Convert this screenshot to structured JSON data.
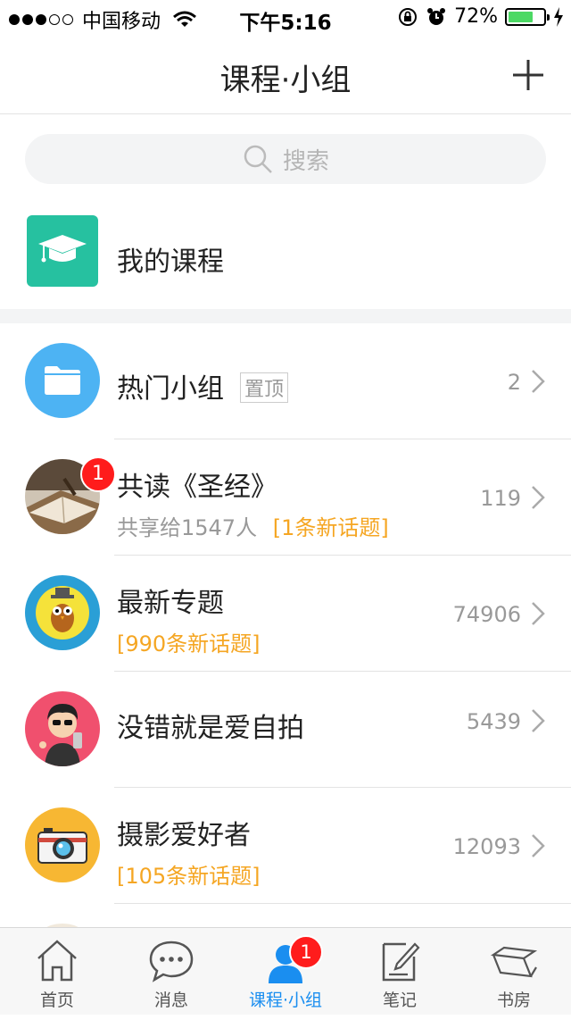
{
  "status_bar": {
    "carrier": "中国移动",
    "time": "下午5:16",
    "battery": "72%",
    "battery_level": 0.72
  },
  "nav": {
    "title": "课程·小组"
  },
  "search": {
    "placeholder": "搜索"
  },
  "my_course": {
    "label": "我的课程"
  },
  "groups": [
    {
      "title": "热门小组",
      "tag": "置顶",
      "count": "2"
    },
    {
      "title": "共读《圣经》",
      "sub_gray": "共享给1547人",
      "sub_orange": "[1条新话题]",
      "count": "119",
      "badge": "1"
    },
    {
      "title": "最新专题",
      "sub_orange": "[990条新话题]",
      "count": "74906"
    },
    {
      "title": "没错就是爱自拍",
      "count": "5439"
    },
    {
      "title": "摄影爱好者",
      "sub_orange": "[105条新话题]",
      "count": "12093"
    }
  ],
  "tabs": [
    {
      "label": "首页",
      "icon": "home-icon"
    },
    {
      "label": "消息",
      "icon": "message-icon"
    },
    {
      "label": "课程·小组",
      "icon": "group-icon",
      "badge": "1",
      "active": true
    },
    {
      "label": "笔记",
      "icon": "note-icon"
    },
    {
      "label": "书房",
      "icon": "books-icon"
    }
  ],
  "colors": {
    "accent": "#1a8ef0",
    "orange": "#f5a623",
    "teal": "#26c1a0",
    "badge": "#ff1c1c"
  }
}
